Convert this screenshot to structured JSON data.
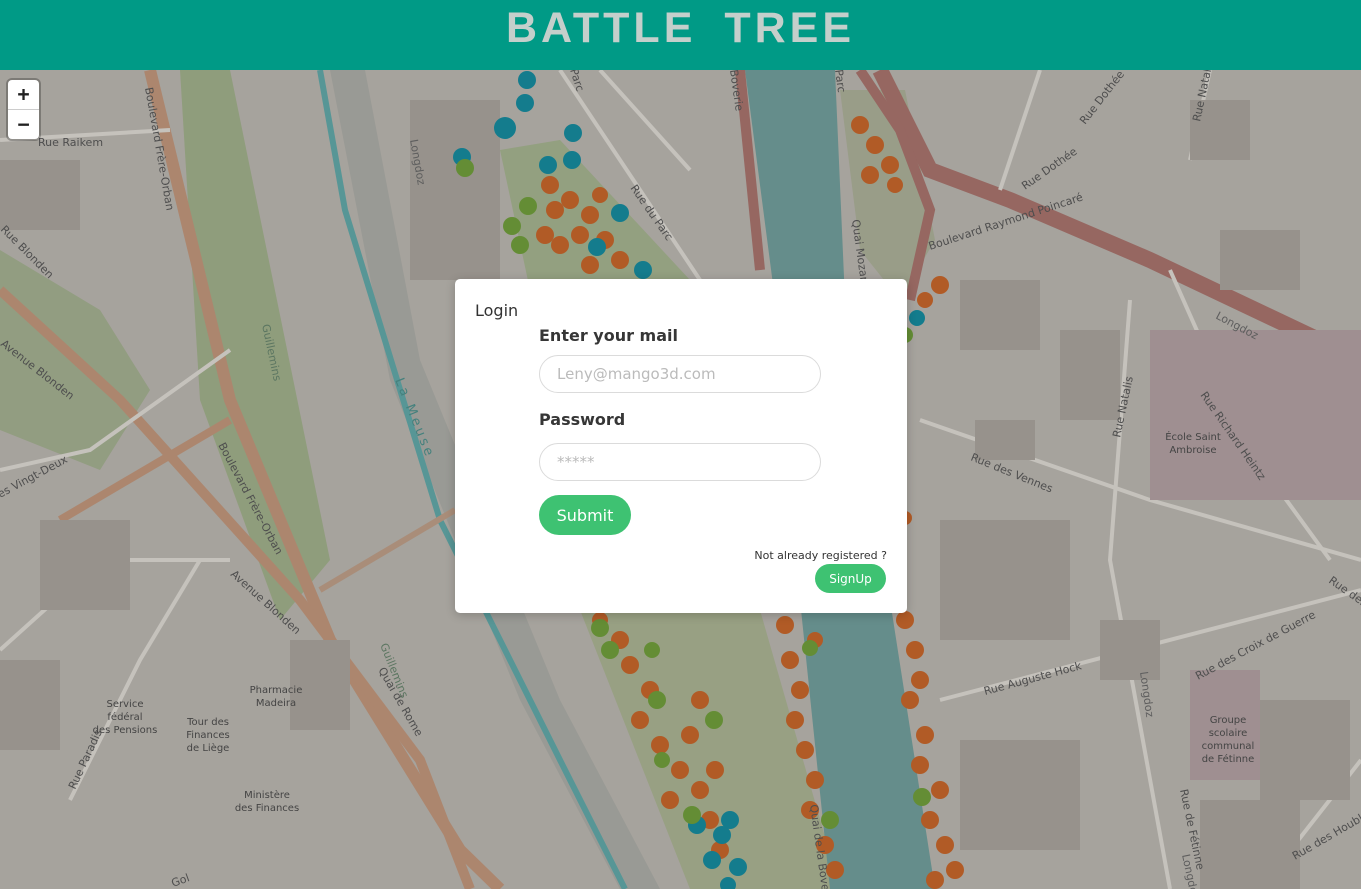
{
  "header": {
    "title": "BATTLE  TREE"
  },
  "zoom": {
    "in_label": "+",
    "out_label": "−"
  },
  "login": {
    "title": "Login",
    "mail_label": "Enter your mail",
    "mail_placeholder": "Leny@mango3d.com",
    "password_label": "Password",
    "password_placeholder": "*****",
    "submit_label": "Submit",
    "not_registered": "Not already registered ?",
    "signup_label": "SignUp"
  },
  "map": {
    "streets": [
      "Rue Raikem",
      "Boulevard Frère-Orban",
      "Rue Blonden",
      "Avenue Blonden",
      "Rue des Vingt-Deux",
      "Guillemins",
      "La Meuse",
      "Longdoz",
      "Rue du Parc",
      "Parc",
      "Boverie",
      "Quai Mozart",
      "Rue Dothée",
      "Boulevard Raymond Poincaré",
      "Rue Natalis",
      "Rue Richard Heintz",
      "Rue des Vennes",
      "Rue Auguste Hock",
      "Rue des Croix de Guerre",
      "Rue de Fétinne",
      "Rue des Houblo",
      "Quai de Rome",
      "Rue Paradis",
      "Quai de la Boverie",
      "Rue des"
    ],
    "pois": [
      "École Saint Ambroise",
      "Pharmacie Madeira",
      "Service fédéral des Pensions",
      "Tour des Finances de Liège",
      "Ministère des Finances",
      "Groupe scolaire communal de Fétinne"
    ],
    "colors": {
      "background": "#b5b1ab",
      "water": "#6e9a97",
      "park": "#9fb08a",
      "tree_autumn": "#c0632a",
      "tree_teal": "#16879a",
      "tree_green": "#6d9a3a",
      "header": "#009a86",
      "button": "#3ec272"
    }
  }
}
